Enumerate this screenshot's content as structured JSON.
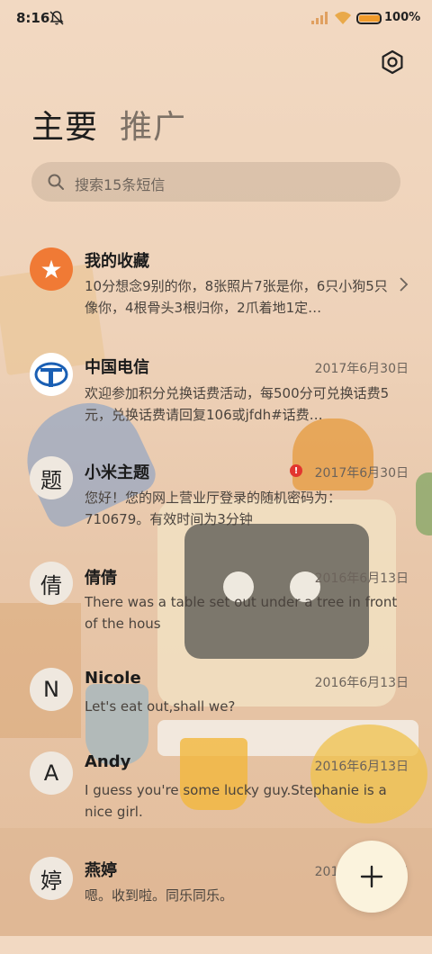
{
  "status_bar": {
    "time": "8:16",
    "battery_percent": "100%",
    "battery_level": 0.95,
    "icons": [
      "bell-muted-icon",
      "signal-icon",
      "wifi-icon",
      "battery-icon"
    ]
  },
  "header": {
    "settings_icon": "settings-icon",
    "tabs": [
      {
        "label": "主要",
        "active": true
      },
      {
        "label": "推广",
        "active": false
      }
    ]
  },
  "search": {
    "placeholder": "搜索15条短信",
    "icon": "search-icon"
  },
  "conversations": [
    {
      "name": "我的收藏",
      "date": "",
      "avatar": "★",
      "avatar_type": "star-icon",
      "avatar_color": "#f07a35",
      "snippet": "10分想念9别的你，8张照片7张是你，6只小狗5只像你，4根骨头3根归你，2爪着地1定…",
      "has_chevron": true
    },
    {
      "name": "中国电信",
      "date": "2017年6月30日",
      "avatar": "",
      "avatar_type": "china-telecom-logo",
      "avatar_color": "#1a5fb4",
      "snippet": "欢迎参加积分兑换话费活动，每500分可兑换话费5元，兑换话费请回复106或jfdh#话费…"
    },
    {
      "name": "小米主题",
      "date": "2017年6月30日",
      "avatar": "题",
      "snippet": "您好！您的网上营业厅登录的随机密码为：710679。有效时间为3分钟",
      "alert": "!",
      "alert_color": "#e2362f"
    },
    {
      "name": "倩倩",
      "date": "2016年6月13日",
      "avatar": "倩",
      "snippet": "There was a table set out under a tree in front of the hous"
    },
    {
      "name": "Nicole",
      "date": "2016年6月13日",
      "avatar": "N",
      "snippet": "Let's eat out,shall we?"
    },
    {
      "name": "Andy",
      "date": "2016年6月13日",
      "avatar": "A",
      "snippet": "I guess you're some lucky guy.Stephanie is a nice girl."
    },
    {
      "name": "燕婷",
      "date": "2016年6月13日",
      "avatar": "婷",
      "snippet": "嗯。收到啦。同乐同乐。"
    }
  ],
  "fab": {
    "icon": "plus-icon"
  }
}
